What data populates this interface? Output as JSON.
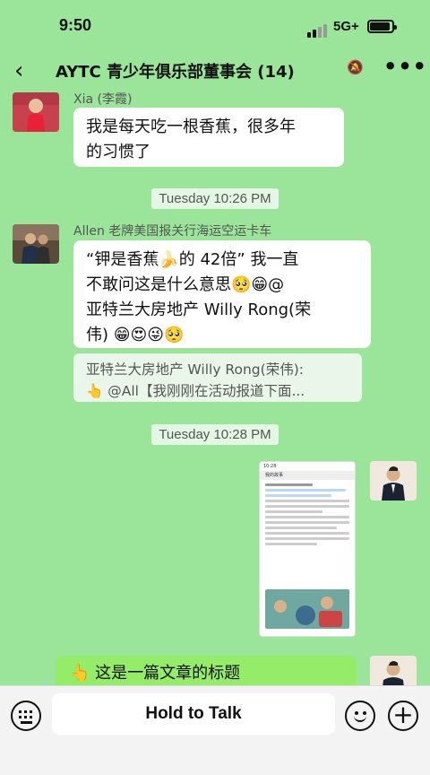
{
  "status": {
    "time": "9:50",
    "network": "5G+"
  },
  "nav": {
    "back_icon": "‹",
    "title": "AYTC 青少年俱乐部董事会 (14)",
    "mute_icon": "🔕",
    "more_icon": "•••"
  },
  "messages": [
    {
      "sender": "Xia (李霞)",
      "text_line1": "我是每天吃一根香蕉，很多年",
      "text_line2": "的习惯了"
    },
    {
      "timestamp": "Tuesday 10:26 PM"
    },
    {
      "sender": "Allen 老牌美国报关行海运空运卡车",
      "text_line1": "“钾是香蕉🍌的 42倍” 我一直",
      "text_line2": "不敢问这是什么意思🥺😁@",
      "text_line3": "亚特兰大房地产 Willy Rong(荣",
      "text_line4": "伟) 😁😍😜🥺",
      "quote_line1": "亚特兰大房地产 Willy Rong(荣伟):",
      "quote_line2": "👆 @All【我刚刚在活动报道下面..."
    },
    {
      "timestamp": "Tuesday 10:28 PM"
    },
    {
      "article_time": "10:28",
      "article_title": "我的故事"
    },
    {
      "self_text": "👆 这是一篇文章的标题"
    }
  ],
  "input": {
    "hold_to_talk": "Hold to Talk"
  },
  "colors": {
    "background": "#9be59a",
    "bubble": "#ffffff",
    "self_bubble": "#95ec69"
  }
}
